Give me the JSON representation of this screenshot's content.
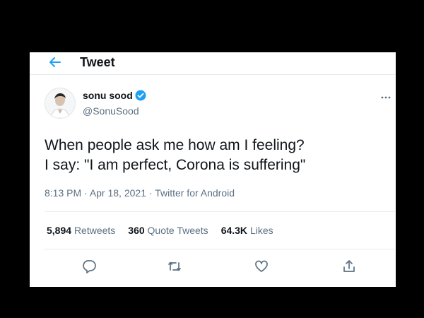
{
  "header": {
    "title": "Tweet",
    "back_icon": "back-arrow-icon"
  },
  "author": {
    "name": "sonu sood",
    "handle": "@SonuSood",
    "verified_icon": "verified-badge-icon"
  },
  "tweet": {
    "lines": [
      "When people ask me how am I feeling?",
      "I say: \"I am perfect, Corona is suffering\""
    ],
    "time": "8:13 PM",
    "date": "Apr 18, 2021",
    "source": "Twitter for Android",
    "separator": "·"
  },
  "stats": {
    "retweets_count": "5,894",
    "retweets_label": "Retweets",
    "quote_count": "360",
    "quote_label": "Quote Tweets",
    "likes_count": "64.3K",
    "likes_label": "Likes"
  },
  "actions": [
    "reply-icon",
    "retweet-icon",
    "like-icon",
    "share-icon"
  ],
  "colors": {
    "accent": "#1da1f2",
    "text": "#0f1419",
    "muted": "#5b7083",
    "divider": "#e6ecf0",
    "page_background": "#000000",
    "card_background": "#ffffff"
  }
}
